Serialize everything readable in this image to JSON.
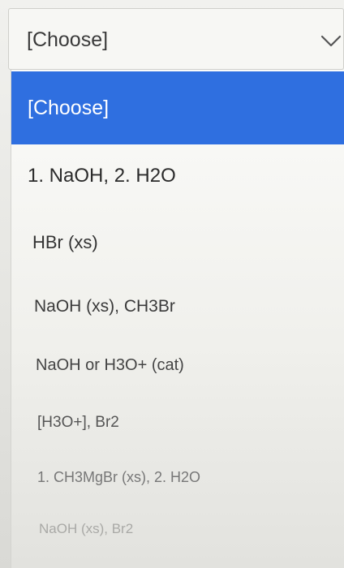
{
  "select": {
    "value": "[Choose]",
    "icon": "chevron-down-icon"
  },
  "dropdown": {
    "options": [
      {
        "label": "[Choose]",
        "selected": true
      },
      {
        "label": "1. NaOH, 2. H2O"
      },
      {
        "label": "HBr (xs)"
      },
      {
        "label": "NaOH (xs), CH3Br"
      },
      {
        "label": "NaOH or H3O+ (cat)"
      },
      {
        "label": "[H3O+], Br2"
      },
      {
        "label": "1. CH3MgBr (xs), 2. H2O"
      },
      {
        "label": "NaOH (xs), Br2"
      }
    ]
  },
  "colors": {
    "selected_bg": "#2f6fe0",
    "selected_text": "#ffffff",
    "option_text": "#2b2b2b"
  }
}
